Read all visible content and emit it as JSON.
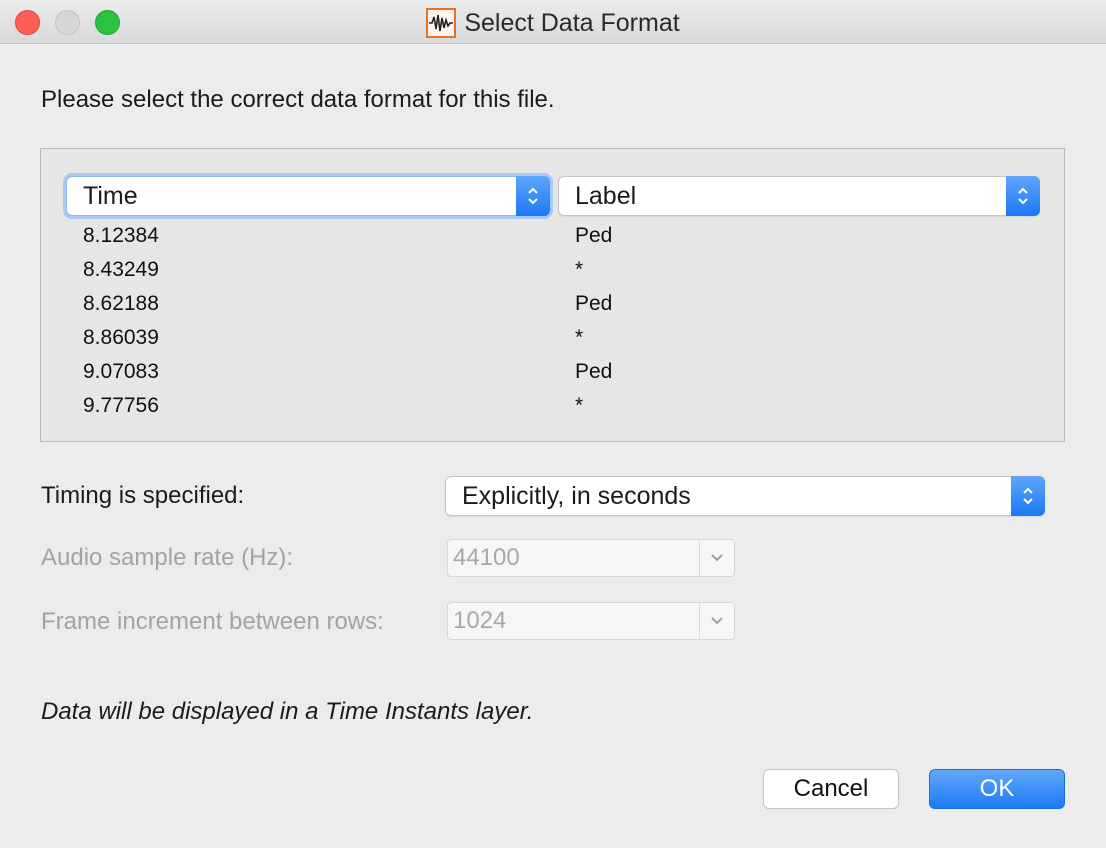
{
  "window": {
    "title": "Select Data Format",
    "app_icon": "waveform-icon"
  },
  "prompt": "Please select the correct data format for this file.",
  "columns": [
    {
      "header": "Time",
      "values": [
        "8.12384",
        "8.43249",
        "8.62188",
        "8.86039",
        "9.07083",
        "9.77756"
      ]
    },
    {
      "header": "Label",
      "values": [
        "Ped",
        "*",
        "Ped",
        "*",
        "Ped",
        "*"
      ]
    }
  ],
  "timing": {
    "label": "Timing is specified:",
    "value": "Explicitly, in seconds"
  },
  "sample_rate": {
    "label": "Audio sample rate (Hz):",
    "value": "44100"
  },
  "frame_increment": {
    "label": "Frame increment between rows:",
    "value": "1024"
  },
  "note": "Data will be displayed in a Time Instants layer.",
  "buttons": {
    "cancel": "Cancel",
    "ok": "OK"
  },
  "colors": {
    "accent": "#1a78f4",
    "close": "#fc5f57",
    "zoom": "#29c33f",
    "icon_border": "#e0752a"
  }
}
